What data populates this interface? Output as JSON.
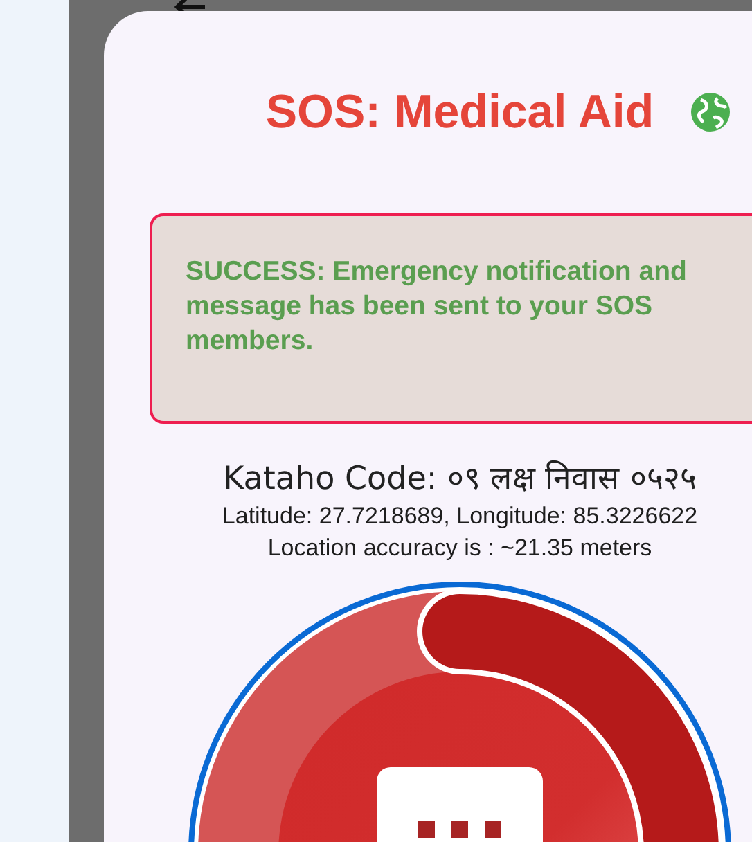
{
  "dialog": {
    "title": "SOS: Medical Aid",
    "alert": {
      "kind": "success",
      "message": "SUCCESS: Emergency notification and message has been sent to your SOS members."
    },
    "kataho_code": "Kataho Code: ०९ लक्ष निवास ०५२५",
    "coordinates": "Latitude: 27.7218689, Longitude: 85.3226622",
    "accuracy": "Location accuracy is : ~21.35 meters"
  }
}
